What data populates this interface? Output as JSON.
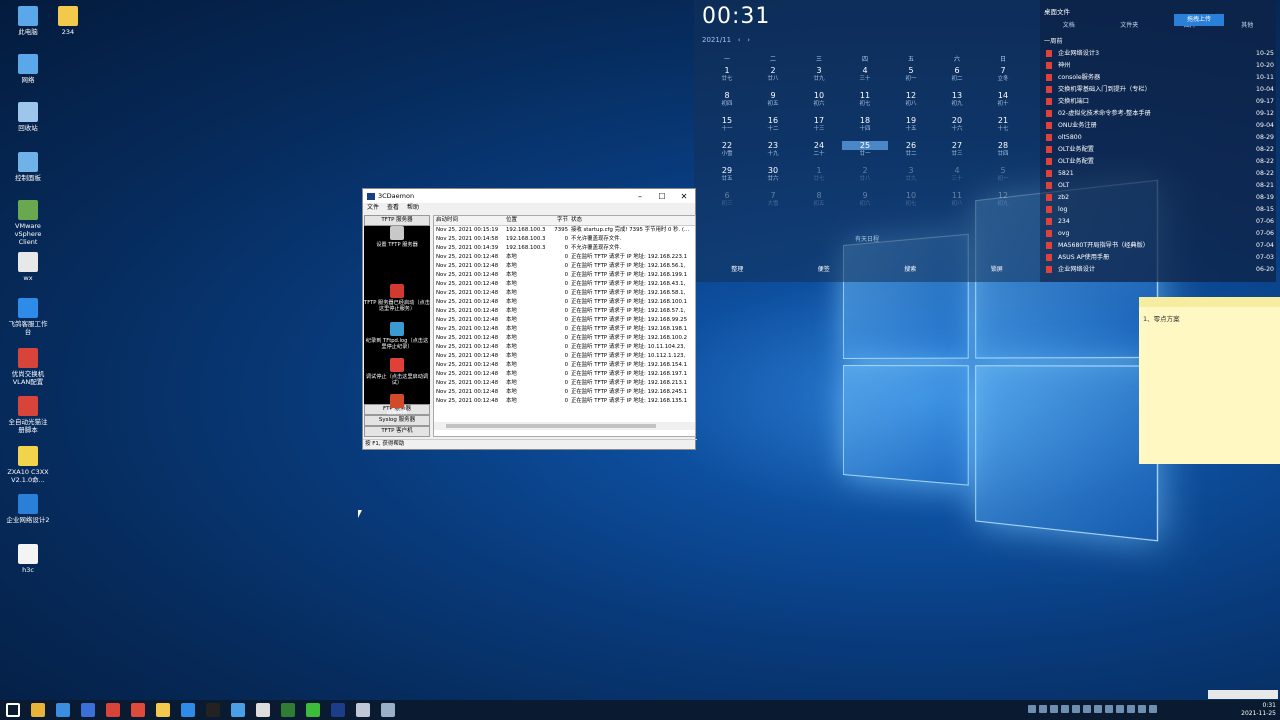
{
  "desktop_icons": [
    {
      "label": "此电脑",
      "icon": "computer-icon",
      "color": "#5aa7ea"
    },
    {
      "label": "234",
      "icon": "folder-icon",
      "color": "#f2c94c"
    },
    {
      "label": "网络",
      "icon": "network-icon",
      "color": "#5aa7ea"
    },
    {
      "label": "回收站",
      "icon": "recycle-bin-icon",
      "color": "#9ec6ea"
    },
    {
      "label": "控制面板",
      "icon": "control-panel-icon",
      "color": "#6fb2e8"
    },
    {
      "label": "VMware vSphere Client",
      "icon": "vmware-icon",
      "color": "#6aa84f"
    },
    {
      "label": "wx",
      "icon": "file-icon",
      "color": "#e8e8e8"
    },
    {
      "label": "飞鸽客服工作台",
      "icon": "feige-icon",
      "color": "#2e8be8"
    },
    {
      "label": "优尚交换机VLAN配置",
      "icon": "pdf-icon",
      "color": "#d9443a"
    },
    {
      "label": "全自动光猫注册脚本",
      "icon": "pdf-icon",
      "color": "#d9443a"
    },
    {
      "label": "ZXA10 C3XX V2.1.0命...",
      "icon": "help-icon",
      "color": "#f2d34c"
    },
    {
      "label": "企业网络设计2",
      "icon": "edge-icon",
      "color": "#2a7fd8"
    },
    {
      "label": "h3c",
      "icon": "blank-file-icon",
      "color": "#f4f4f4"
    }
  ],
  "calendar": {
    "clock": "00:31",
    "month": "2021/11",
    "prev": "‹",
    "next": "›",
    "weekdays": [
      "一",
      "二",
      "三",
      "四",
      "五",
      "六",
      "日"
    ],
    "weeks": [
      [
        {
          "n": "1",
          "l": "廿七"
        },
        {
          "n": "2",
          "l": "廿八"
        },
        {
          "n": "3",
          "l": "廿九"
        },
        {
          "n": "4",
          "l": "三十"
        },
        {
          "n": "5",
          "l": "初一"
        },
        {
          "n": "6",
          "l": "初二"
        },
        {
          "n": "7",
          "l": "立冬"
        }
      ],
      [
        {
          "n": "8",
          "l": "初四"
        },
        {
          "n": "9",
          "l": "初五"
        },
        {
          "n": "10",
          "l": "初六"
        },
        {
          "n": "11",
          "l": "初七"
        },
        {
          "n": "12",
          "l": "初八"
        },
        {
          "n": "13",
          "l": "初九"
        },
        {
          "n": "14",
          "l": "初十"
        }
      ],
      [
        {
          "n": "15",
          "l": "十一"
        },
        {
          "n": "16",
          "l": "十二"
        },
        {
          "n": "17",
          "l": "十三"
        },
        {
          "n": "18",
          "l": "十四"
        },
        {
          "n": "19",
          "l": "十五"
        },
        {
          "n": "20",
          "l": "十六"
        },
        {
          "n": "21",
          "l": "十七"
        }
      ],
      [
        {
          "n": "22",
          "l": "小雪"
        },
        {
          "n": "23",
          "l": "十九"
        },
        {
          "n": "24",
          "l": "二十"
        },
        {
          "n": "25",
          "l": "廿一"
        },
        {
          "n": "26",
          "l": "廿二"
        },
        {
          "n": "27",
          "l": "廿三"
        },
        {
          "n": "28",
          "l": "廿四"
        }
      ],
      [
        {
          "n": "29",
          "l": "廿五"
        },
        {
          "n": "30",
          "l": "廿六"
        },
        {
          "n": "1",
          "l": "廿七"
        },
        {
          "n": "2",
          "l": "廿八"
        },
        {
          "n": "3",
          "l": "廿九"
        },
        {
          "n": "4",
          "l": "三十"
        },
        {
          "n": "5",
          "l": "初一"
        }
      ],
      [
        {
          "n": "6",
          "l": "初三"
        },
        {
          "n": "7",
          "l": "大雪"
        },
        {
          "n": "8",
          "l": "初五"
        },
        {
          "n": "9",
          "l": "初六"
        },
        {
          "n": "10",
          "l": "初七"
        },
        {
          "n": "11",
          "l": "初八"
        },
        {
          "n": "12",
          "l": "初九"
        }
      ]
    ],
    "footer": "有天日程",
    "actions": [
      "整理",
      "便签",
      "搜索",
      "锁屏"
    ]
  },
  "files_widget": {
    "title": "桌面文件",
    "tabs": [
      "文档",
      "文件夹",
      "图片",
      "其他"
    ],
    "upload": "拖拽上传",
    "group": "一周前",
    "items": [
      {
        "name": "企业网络设计3",
        "date": "10-25"
      },
      {
        "name": "神州",
        "date": "10-20"
      },
      {
        "name": "console服务器",
        "date": "10-11"
      },
      {
        "name": "交换机零基础入门到提升（专栏）",
        "date": "10-04"
      },
      {
        "name": "交换机端口",
        "date": "09-17"
      },
      {
        "name": "02-虚拟化技术命令参考-整本手册",
        "date": "09-12"
      },
      {
        "name": "ONU业务注册",
        "date": "09-04"
      },
      {
        "name": "olt5800",
        "date": "08-29"
      },
      {
        "name": "OLT业务配置",
        "date": "08-22"
      },
      {
        "name": "OLT业务配置",
        "date": "08-22"
      },
      {
        "name": "5821",
        "date": "08-22"
      },
      {
        "name": "OLT",
        "date": "08-21"
      },
      {
        "name": "zb2",
        "date": "08-19"
      },
      {
        "name": "log",
        "date": "08-15"
      },
      {
        "name": "234",
        "date": "07-06"
      },
      {
        "name": "ovg",
        "date": "07-06"
      },
      {
        "name": "MA5680T开局指导书（经典版）",
        "date": "07-04"
      },
      {
        "name": "ASUS AP使用手册",
        "date": "07-03"
      },
      {
        "name": "企业网络设计",
        "date": "06-20"
      }
    ]
  },
  "sticky_note": {
    "text": "1、零点方案"
  },
  "daemon": {
    "title": "3CDaemon",
    "menu": [
      "文件",
      "查看",
      "帮助"
    ],
    "left_header": "TFTP 服务器",
    "left_buttons": [
      "设置 TFTP 服务器",
      "TFTP 服务器已经启动（点击这里停止服务）",
      "纪录到 TFtpd.log（点击这里停止纪录）",
      "调试停止（点击这里启动调试）",
      "清除列表"
    ],
    "left_bottom": [
      "FTP 服务器",
      "Syslog 服务器",
      "TFTP 客户机"
    ],
    "columns": [
      "启动时间",
      "位置",
      "字节",
      "状态"
    ],
    "rows": [
      [
        "Nov 25, 2021 00:15:19",
        "192.168.100.3",
        "7395",
        "接收 startup.cfg 完成! 7395 字节用时 0 秒. (..."
      ],
      [
        "Nov 25, 2021 00:14:58",
        "192.168.100.3",
        "0",
        "不允许覆盖现存文件."
      ],
      [
        "Nov 25, 2021 00:14:39",
        "192.168.100.3",
        "0",
        "不允许覆盖现存文件."
      ],
      [
        "Nov 25, 2021 00:12:48",
        "本地",
        "0",
        "正在监听 TFTP 请求于 IP 地址: 192.168.223.1"
      ],
      [
        "Nov 25, 2021 00:12:48",
        "本地",
        "0",
        "正在监听 TFTP 请求于 IP 地址: 192.168.56.1,"
      ],
      [
        "Nov 25, 2021 00:12:48",
        "本地",
        "0",
        "正在监听 TFTP 请求于 IP 地址: 192.168.199.1"
      ],
      [
        "Nov 25, 2021 00:12:48",
        "本地",
        "0",
        "正在监听 TFTP 请求于 IP 地址: 192.168.43.1,"
      ],
      [
        "Nov 25, 2021 00:12:48",
        "本地",
        "0",
        "正在监听 TFTP 请求于 IP 地址: 192.168.58.1,"
      ],
      [
        "Nov 25, 2021 00:12:48",
        "本地",
        "0",
        "正在监听 TFTP 请求于 IP 地址: 192.168.100.1"
      ],
      [
        "Nov 25, 2021 00:12:48",
        "本地",
        "0",
        "正在监听 TFTP 请求于 IP 地址: 192.168.57.1,"
      ],
      [
        "Nov 25, 2021 00:12:48",
        "本地",
        "0",
        "正在监听 TFTP 请求于 IP 地址: 192.168.99.25"
      ],
      [
        "Nov 25, 2021 00:12:48",
        "本地",
        "0",
        "正在监听 TFTP 请求于 IP 地址: 192.168.198.1"
      ],
      [
        "Nov 25, 2021 00:12:48",
        "本地",
        "0",
        "正在监听 TFTP 请求于 IP 地址: 192.168.100.2"
      ],
      [
        "Nov 25, 2021 00:12:48",
        "本地",
        "0",
        "正在监听 TFTP 请求于 IP 地址: 10.11.104.23,"
      ],
      [
        "Nov 25, 2021 00:12:48",
        "本地",
        "0",
        "正在监听 TFTP 请求于 IP 地址: 10.112.1.123,"
      ],
      [
        "Nov 25, 2021 00:12:48",
        "本地",
        "0",
        "正在监听 TFTP 请求于 IP 地址: 192.168.154.1"
      ],
      [
        "Nov 25, 2021 00:12:48",
        "本地",
        "0",
        "正在监听 TFTP 请求于 IP 地址: 192.168.197.1"
      ],
      [
        "Nov 25, 2021 00:12:48",
        "本地",
        "0",
        "正在监听 TFTP 请求于 IP 地址: 192.168.213.1"
      ],
      [
        "Nov 25, 2021 00:12:48",
        "本地",
        "0",
        "正在监听 TFTP 请求于 IP 地址: 192.168.245.1"
      ],
      [
        "Nov 25, 2021 00:12:48",
        "本地",
        "0",
        "正在监听 TFTP 请求于 IP 地址: 192.168.135.1"
      ]
    ],
    "status": "按 F1, 获得帮助"
  },
  "taskbar": {
    "apps": [
      {
        "icon": "start-icon",
        "color": "#ffffff"
      },
      {
        "icon": "chrome-icon",
        "color": "#e8b339"
      },
      {
        "icon": "browser-icon",
        "color": "#3b8de0"
      },
      {
        "icon": "mail-icon",
        "color": "#3b6fd8"
      },
      {
        "icon": "wps-icon",
        "color": "#d9443a"
      },
      {
        "icon": "pdf-icon",
        "color": "#e04a3a"
      },
      {
        "icon": "explorer-icon",
        "color": "#f2c94c"
      },
      {
        "icon": "feige-icon",
        "color": "#2e8be8"
      },
      {
        "icon": "terminal-icon",
        "color": "#222222"
      },
      {
        "icon": "remote-icon",
        "color": "#4aa0e6"
      },
      {
        "icon": "notepad-icon",
        "color": "#dddddd"
      },
      {
        "icon": "excel-icon",
        "color": "#2e7d32"
      },
      {
        "icon": "wechat-icon",
        "color": "#3dbb3a"
      },
      {
        "icon": "3cd-icon",
        "color": "#1b3d8a"
      },
      {
        "icon": "screenshot-icon",
        "color": "#c0c8d8"
      },
      {
        "icon": "window-icon",
        "color": "#9ab0c8"
      }
    ],
    "time": "0:31",
    "date": "2021-11-25"
  }
}
